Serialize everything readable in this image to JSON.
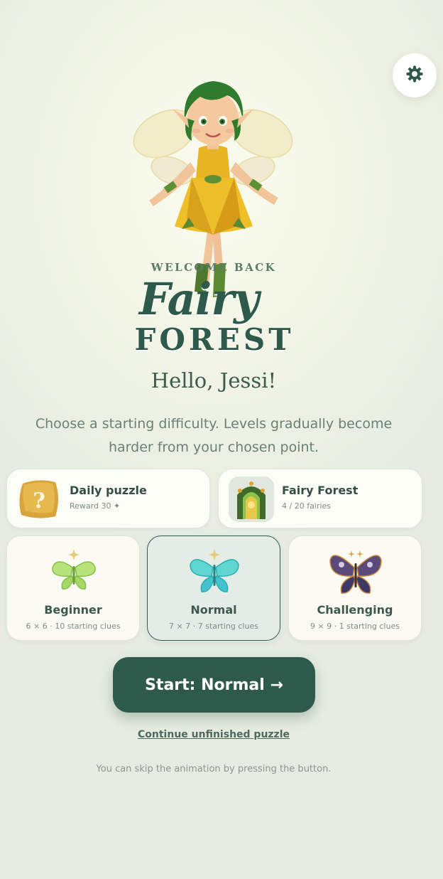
{
  "settings": {
    "icon": "gear-icon"
  },
  "hero": {
    "welcome": "WELCOME BACK",
    "logo_script": "Fairy",
    "logo_serif": "FOREST",
    "greeting": "Hello, Jessi!",
    "intro": "Choose a starting difficulty. Levels gradually become harder from your chosen point."
  },
  "cards": {
    "daily": {
      "title": "Daily puzzle",
      "subtitle": "Reward 30 ✦",
      "icon": "question-mark-icon"
    },
    "forest": {
      "title": "Fairy Forest",
      "subtitle": "4 / 20 fairies",
      "icon": "forest-portal-icon"
    }
  },
  "difficulties": [
    {
      "name": "Beginner",
      "details": "6 × 6 · 10 starting clues",
      "selected": false,
      "icon": "green-butterfly-icon"
    },
    {
      "name": "Normal",
      "details": "7 × 7 · 7 starting clues",
      "selected": true,
      "icon": "teal-butterfly-icon"
    },
    {
      "name": "Challenging",
      "details": "9 × 9 · 1 starting clues",
      "selected": false,
      "icon": "purple-butterfly-icon"
    }
  ],
  "actions": {
    "start_label": "Start: Normal →",
    "continue_label": "Continue unfinished puzzle",
    "hint": "You can skip the animation by pressing the button."
  },
  "colors": {
    "accent": "#2e5a4c",
    "background": "#f2f5e6",
    "card": "#fdfdf7",
    "selected_card": "#e3ede6"
  }
}
